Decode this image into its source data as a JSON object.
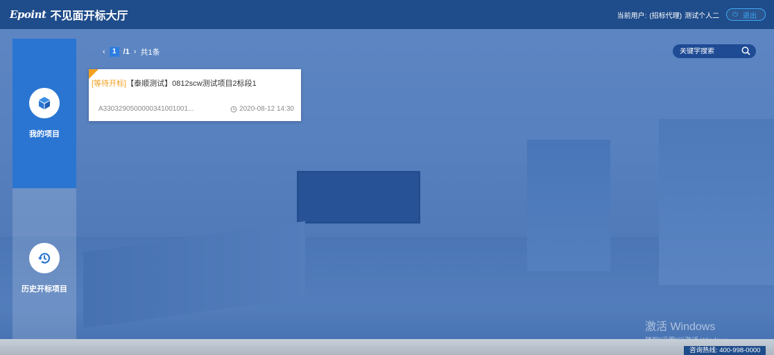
{
  "header": {
    "logo_text": "Epoint",
    "title": "不见面开标大厅",
    "user_label": "当前用户:",
    "user_role": "(招标代理)",
    "user_name": "测试个人二",
    "logout_label": "退出"
  },
  "sidebar": {
    "items": [
      {
        "label": "我的项目",
        "icon": "cube-icon",
        "active": true
      },
      {
        "label": "历史开标项目",
        "icon": "history-icon",
        "active": false
      }
    ]
  },
  "pager": {
    "prev": "‹",
    "current": "1",
    "total_pages": "/1",
    "next": "›",
    "total_count": "共1条"
  },
  "search": {
    "placeholder": "关键字搜索"
  },
  "projects": [
    {
      "status": "[等待开标]",
      "name": "【泰顺测试】0812scw测试项目2标段1",
      "code": "A3303290500000341001001...",
      "time": "2020-08-12 14:30"
    }
  ],
  "watermark": {
    "title": "激活 Windows",
    "subtitle": "转到\"设置\"以激活 Windows。"
  },
  "footer": {
    "hotline": "咨询热线: 400-998-0000"
  },
  "colors": {
    "header_bg": "#1f4c8a",
    "overlay": "#275eb2",
    "active_nav": "#2a75d2",
    "status_orange": "#f2a01e",
    "search_bg": "#1f4b95"
  }
}
